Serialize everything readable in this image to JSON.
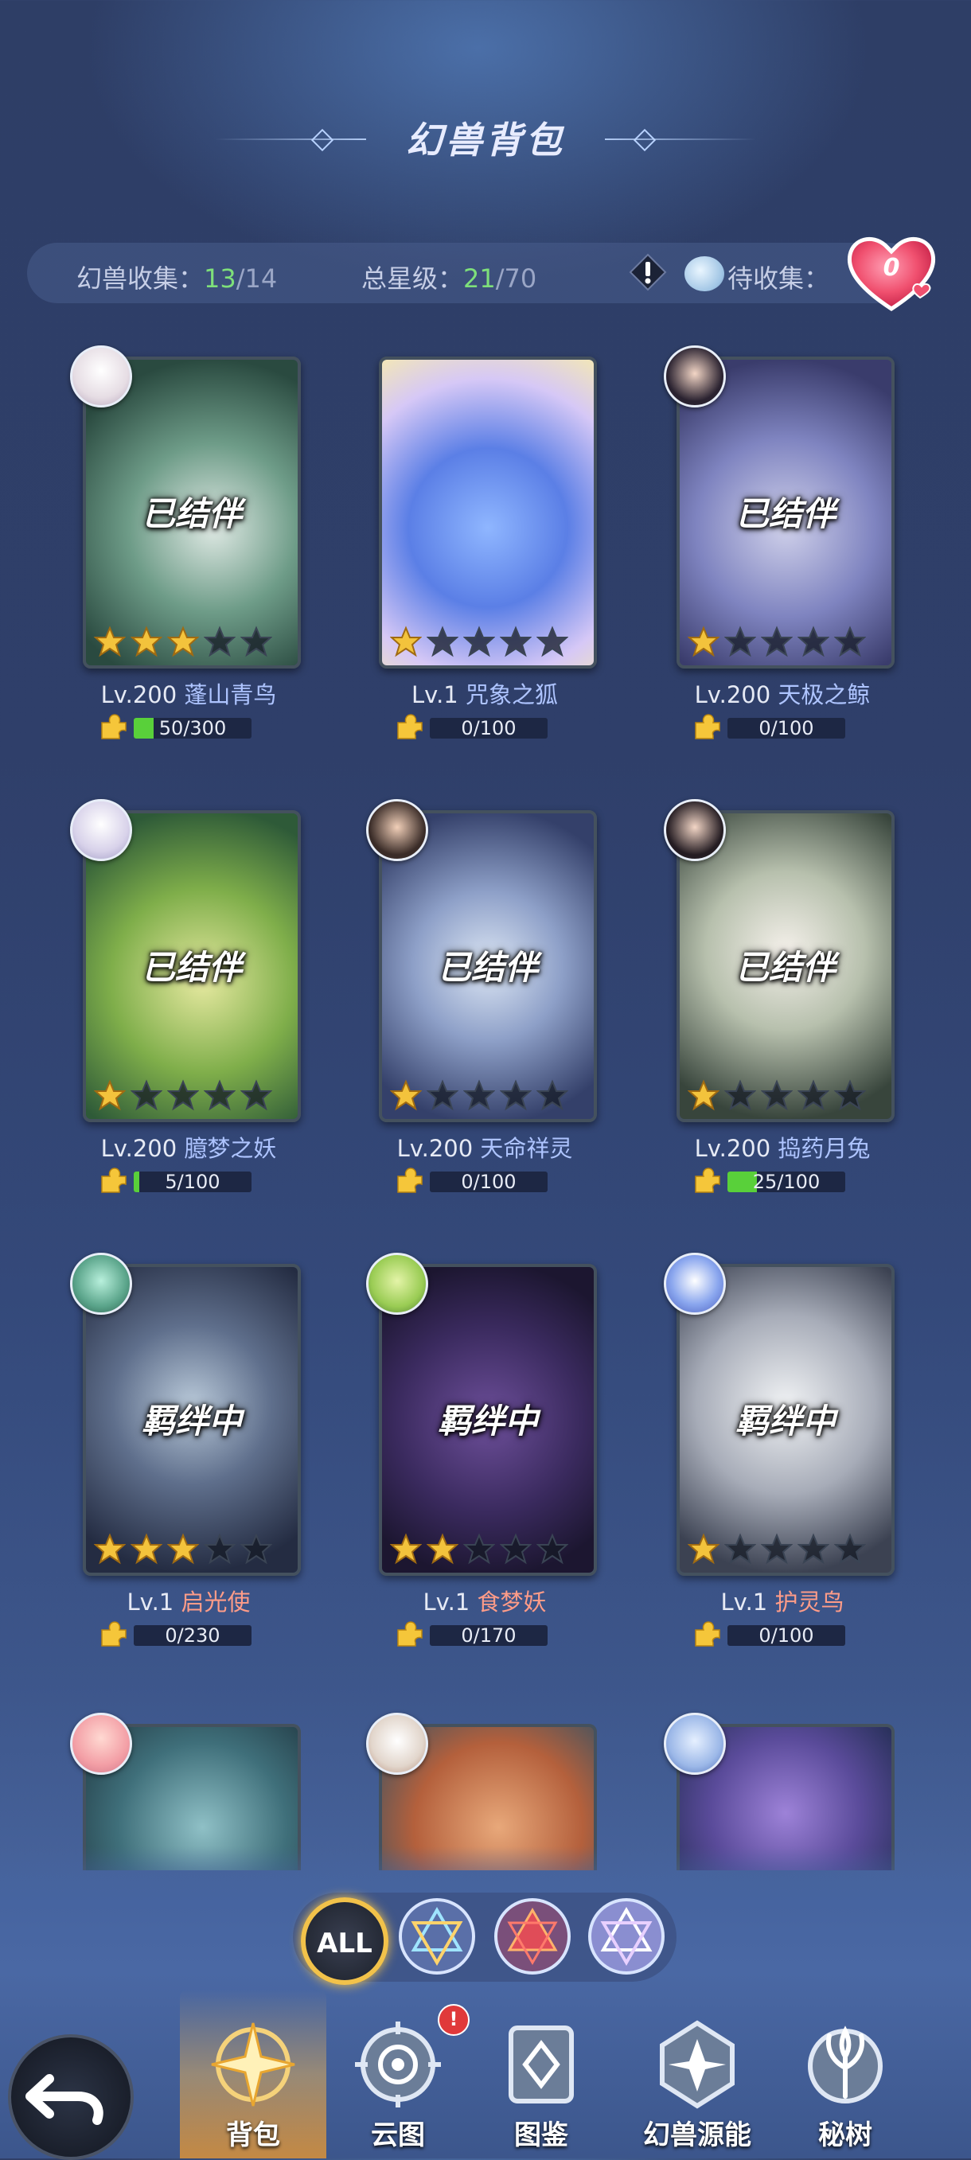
{
  "header": {
    "title": "幻兽背包"
  },
  "stats": {
    "collect_label": "幻兽收集：",
    "collect_have": "13",
    "collect_sep": "/",
    "collect_total": "14",
    "star_label": "总星级：",
    "star_have": "21",
    "star_sep": "/",
    "star_total": "70",
    "pending_label": "待收集：",
    "pending_count": "0"
  },
  "cards": [
    {
      "status": "已结伴",
      "level": "Lv.200",
      "name": "蓬山青鸟",
      "progress": "50/300",
      "fill": 0.17,
      "stars": 3,
      "name_color": "blue"
    },
    {
      "status": "",
      "level": "Lv.1",
      "name": "咒象之狐",
      "progress": "0/100",
      "fill": 0,
      "stars": 1,
      "name_color": "blue"
    },
    {
      "status": "已结伴",
      "level": "Lv.200",
      "name": "天极之鲸",
      "progress": "0/100",
      "fill": 0,
      "stars": 1,
      "name_color": "blue"
    },
    {
      "status": "已结伴",
      "level": "Lv.200",
      "name": "臆梦之妖",
      "progress": "5/100",
      "fill": 0.05,
      "stars": 1,
      "name_color": "blue"
    },
    {
      "status": "已结伴",
      "level": "Lv.200",
      "name": "天命祥灵",
      "progress": "0/100",
      "fill": 0,
      "stars": 1,
      "name_color": "blue"
    },
    {
      "status": "已结伴",
      "level": "Lv.200",
      "name": "捣药月兔",
      "progress": "25/100",
      "fill": 0.25,
      "stars": 1,
      "name_color": "blue"
    },
    {
      "status": "羁绊中",
      "level": "Lv.1",
      "name": "启光使",
      "progress": "0/230",
      "fill": 0,
      "stars": 3,
      "name_color": "pink"
    },
    {
      "status": "羁绊中",
      "level": "Lv.1",
      "name": "食梦妖",
      "progress": "0/170",
      "fill": 0,
      "stars": 2,
      "name_color": "pink"
    },
    {
      "status": "羁绊中",
      "level": "Lv.1",
      "name": "护灵鸟",
      "progress": "0/100",
      "fill": 0,
      "stars": 1,
      "name_color": "pink"
    }
  ],
  "filters": {
    "all_label": "ALL"
  },
  "nav": {
    "bag": "背包",
    "cloud": "云图",
    "guide": "图鉴",
    "source": "幻兽源能",
    "tree": "秘树",
    "cloud_badge": "!"
  },
  "colors": {
    "accent_green": "#7ee07a",
    "name_blue": "#aec4ff",
    "name_pink": "#ff9c88",
    "star_gold": "#f3c33c"
  }
}
